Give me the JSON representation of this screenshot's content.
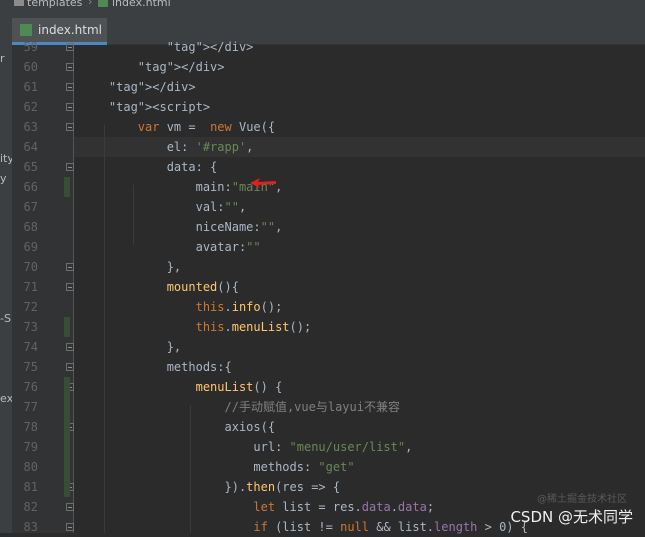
{
  "breadcrumb": {
    "folder": "templates",
    "file": "index.html"
  },
  "tab": {
    "label": "index.html"
  },
  "left_strip": [
    "r",
    "ity",
    "y",
    "-S",
    "ext"
  ],
  "colors": {
    "tag": "#e8bf6a",
    "keyword": "#cc7832",
    "string": "#6a8759",
    "property": "#9876aa",
    "function": "#ffc66d",
    "comment": "#808080",
    "arrow": "#e02020"
  },
  "lines": [
    {
      "n": "59",
      "t": "            </div>"
    },
    {
      "n": "60",
      "t": "        </div>"
    },
    {
      "n": "61",
      "t": "    </div>"
    },
    {
      "n": "62",
      "t": "    <script>"
    },
    {
      "n": "63",
      "t": "        var vm =  new Vue({"
    },
    {
      "n": "64",
      "t": "            el: '#rapp',"
    },
    {
      "n": "65",
      "t": "            data: {"
    },
    {
      "n": "66",
      "t": "                main:\"main\","
    },
    {
      "n": "67",
      "t": "                val:\"\","
    },
    {
      "n": "68",
      "t": "                niceName:\"\","
    },
    {
      "n": "69",
      "t": "                avatar:\"\""
    },
    {
      "n": "70",
      "t": "            },"
    },
    {
      "n": "71",
      "t": "            mounted(){"
    },
    {
      "n": "72",
      "t": "                this.info();"
    },
    {
      "n": "73",
      "t": "                this.menuList();"
    },
    {
      "n": "74",
      "t": "            },"
    },
    {
      "n": "75",
      "t": "            methods:{"
    },
    {
      "n": "76",
      "t": "                menuList() {"
    },
    {
      "n": "77",
      "t": "                    //手动赋值,vue与layui不兼容"
    },
    {
      "n": "78",
      "t": "                    axios({"
    },
    {
      "n": "79",
      "t": "                        url: \"menu/user/list\","
    },
    {
      "n": "80",
      "t": "                        methods: \"get\""
    },
    {
      "n": "81",
      "t": "                    }).then(res => {"
    },
    {
      "n": "82",
      "t": "                        let list = res.data.data;"
    },
    {
      "n": "83",
      "t": "                        if (list != null && list.length > 0) {"
    }
  ],
  "watermark": {
    "main": "CSDN @无术同学",
    "faint": "@稀土掘金技术社区"
  }
}
